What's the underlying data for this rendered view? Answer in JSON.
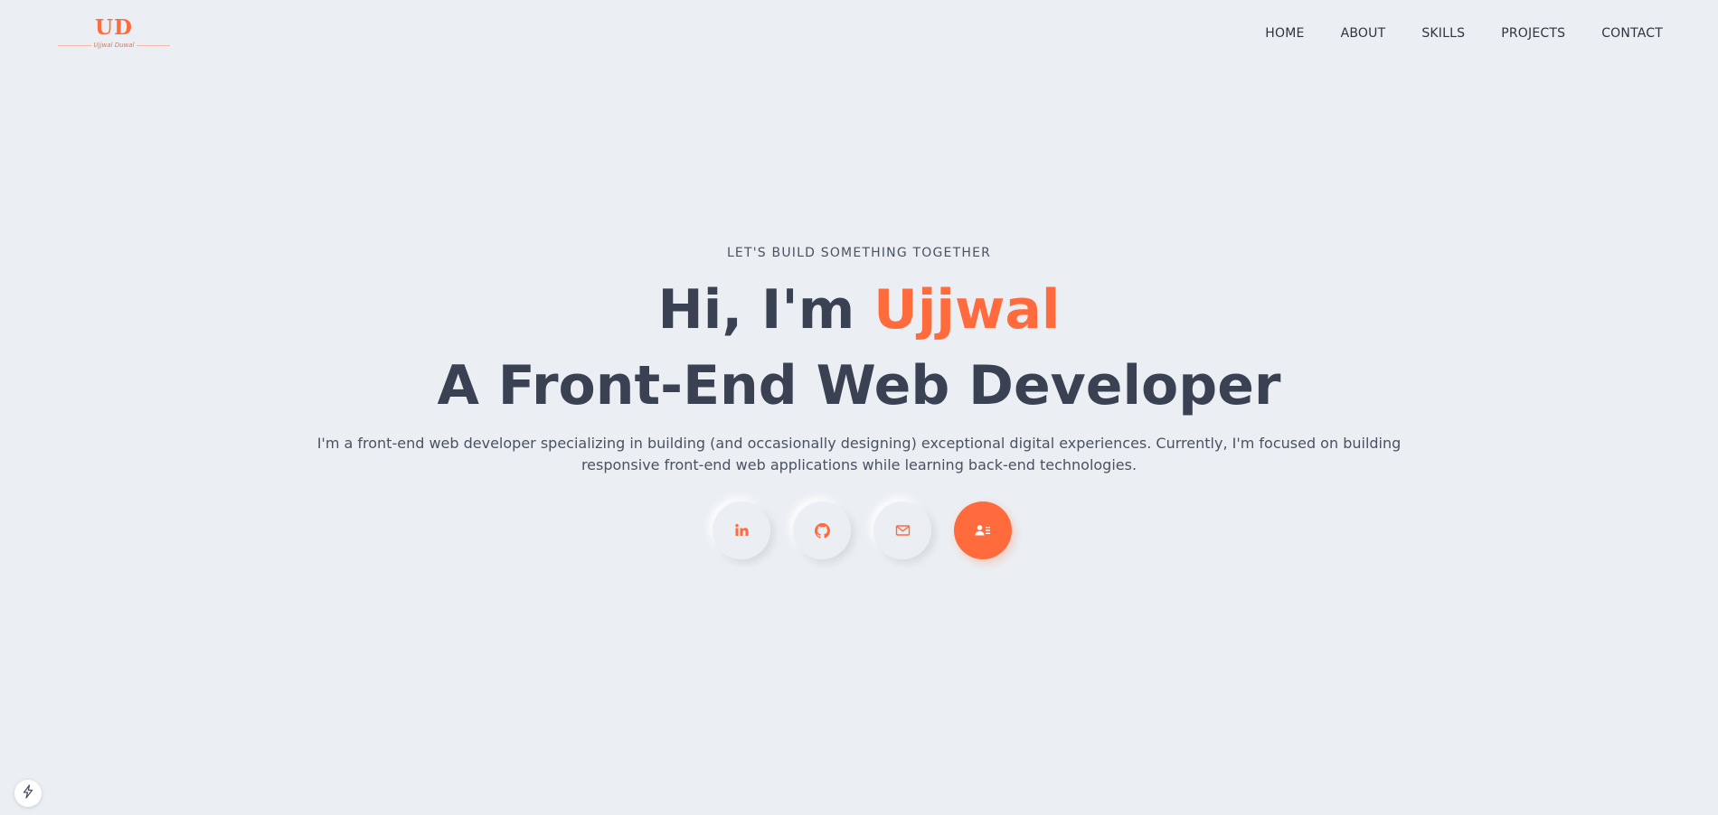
{
  "logo": {
    "mark": "UD",
    "name": "Ujjwal Duwal",
    "icon": "ud-logo"
  },
  "nav": {
    "items": [
      "HOME",
      "ABOUT",
      "SKILLS",
      "PROJECTS",
      "CONTACT"
    ]
  },
  "hero": {
    "eyebrow": "LET'S BUILD SOMETHING TOGETHER",
    "greeting_prefix": "Hi, I'm ",
    "name": "Ujjwal",
    "role": "A Front-End Web Developer",
    "description": "I'm a front-end web developer specializing in building (and occasionally designing) exceptional digital experiences. Currently, I'm focused on building responsive front-end web applications while learning back-end technologies."
  },
  "socials": [
    {
      "icon": "linkedin-icon"
    },
    {
      "icon": "github-icon"
    },
    {
      "icon": "mail-icon"
    },
    {
      "icon": "resume-icon"
    }
  ],
  "corner": {
    "icon": "lightning-icon"
  },
  "colors": {
    "accent": "#ff6b3d",
    "background": "#ebeff3",
    "heading": "#394153",
    "text": "#4a5262"
  }
}
